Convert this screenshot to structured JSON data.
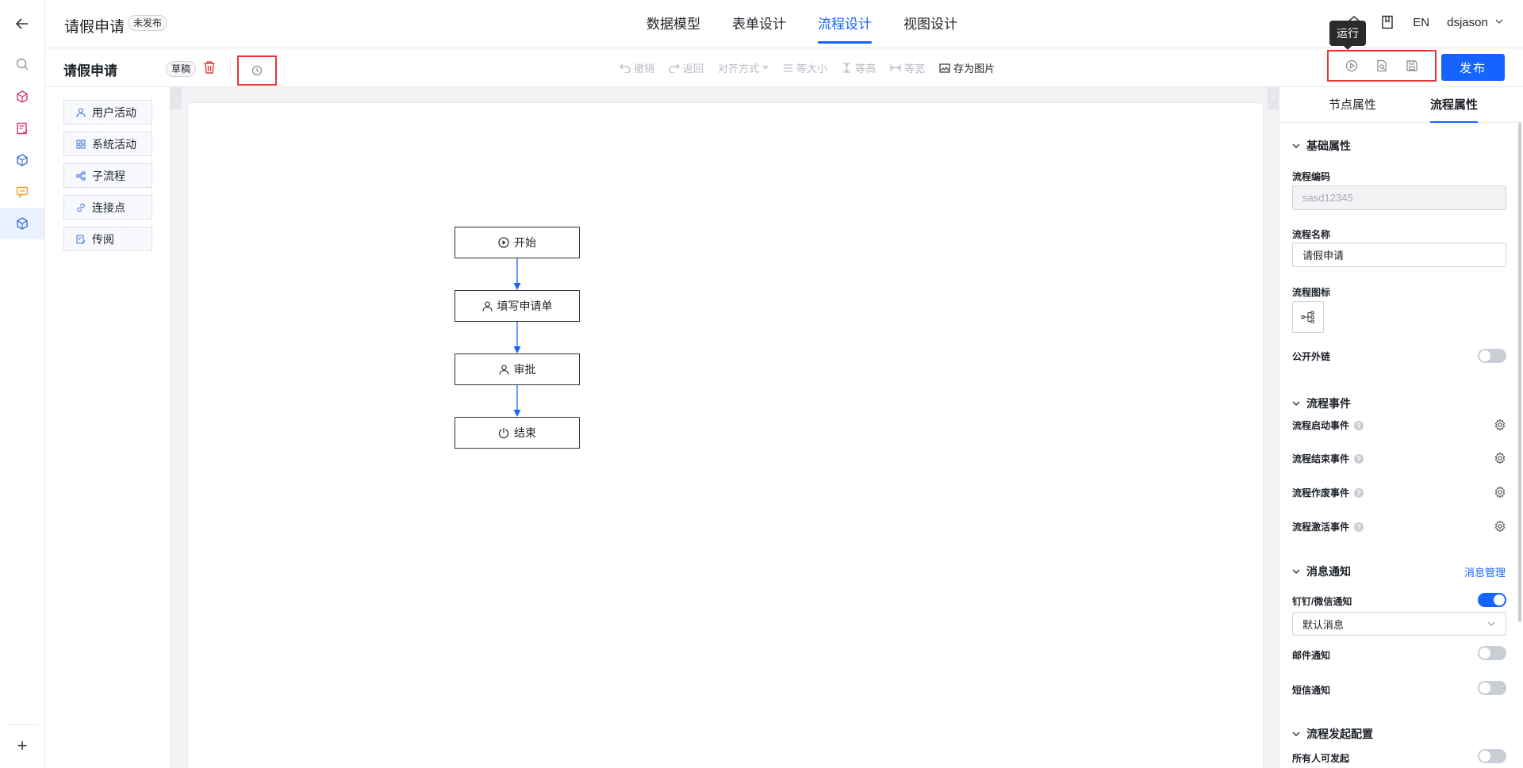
{
  "header": {
    "app_title": "请假申请",
    "status_badge": "未发布",
    "tabs": [
      {
        "label": "数据模型"
      },
      {
        "label": "表单设计"
      },
      {
        "label": "流程设计"
      },
      {
        "label": "视图设计"
      }
    ],
    "lang": "EN",
    "user": "dsjason"
  },
  "toolbar": {
    "process_name": "请假申请",
    "draft_badge": "草稿",
    "undo": "撤销",
    "redo": "返回",
    "align": "对齐方式",
    "same_size": "等大小",
    "same_height": "等高",
    "same_width": "等宽",
    "save_image": "存为图片",
    "run_tooltip": "运行",
    "publish": "发布"
  },
  "palette": {
    "items": [
      {
        "label": "用户活动"
      },
      {
        "label": "系统活动"
      },
      {
        "label": "子流程"
      },
      {
        "label": "连接点"
      },
      {
        "label": "传阅"
      }
    ]
  },
  "flow": {
    "nodes": [
      {
        "label": "开始",
        "icon": "play-circle-icon"
      },
      {
        "label": "填写申请单",
        "icon": "user-icon"
      },
      {
        "label": "审批",
        "icon": "user-icon"
      },
      {
        "label": "结束",
        "icon": "power-icon"
      }
    ]
  },
  "panel": {
    "tabs": [
      {
        "label": "节点属性"
      },
      {
        "label": "流程属性"
      }
    ],
    "basic": {
      "title": "基础属性",
      "code_label": "流程编码",
      "code_value": "sasd12345",
      "name_label": "流程名称",
      "name_value": "请假申请",
      "icon_label": "流程图标",
      "public_link_label": "公开外链"
    },
    "events": {
      "title": "流程事件",
      "items": [
        {
          "label": "流程启动事件"
        },
        {
          "label": "流程结束事件"
        },
        {
          "label": "流程作废事件"
        },
        {
          "label": "流程激活事件"
        }
      ]
    },
    "notify": {
      "title": "消息通知",
      "manage_link": "消息管理",
      "dingtalk_label": "钉钉/微信通知",
      "dingtalk_select": "默认消息",
      "email_label": "邮件通知",
      "sms_label": "短信通知"
    },
    "launch": {
      "title": "流程发起配置",
      "anyone_label": "所有人可发起"
    }
  },
  "colors": {
    "accent": "#1664ff",
    "highlight_box": "#e53935"
  }
}
